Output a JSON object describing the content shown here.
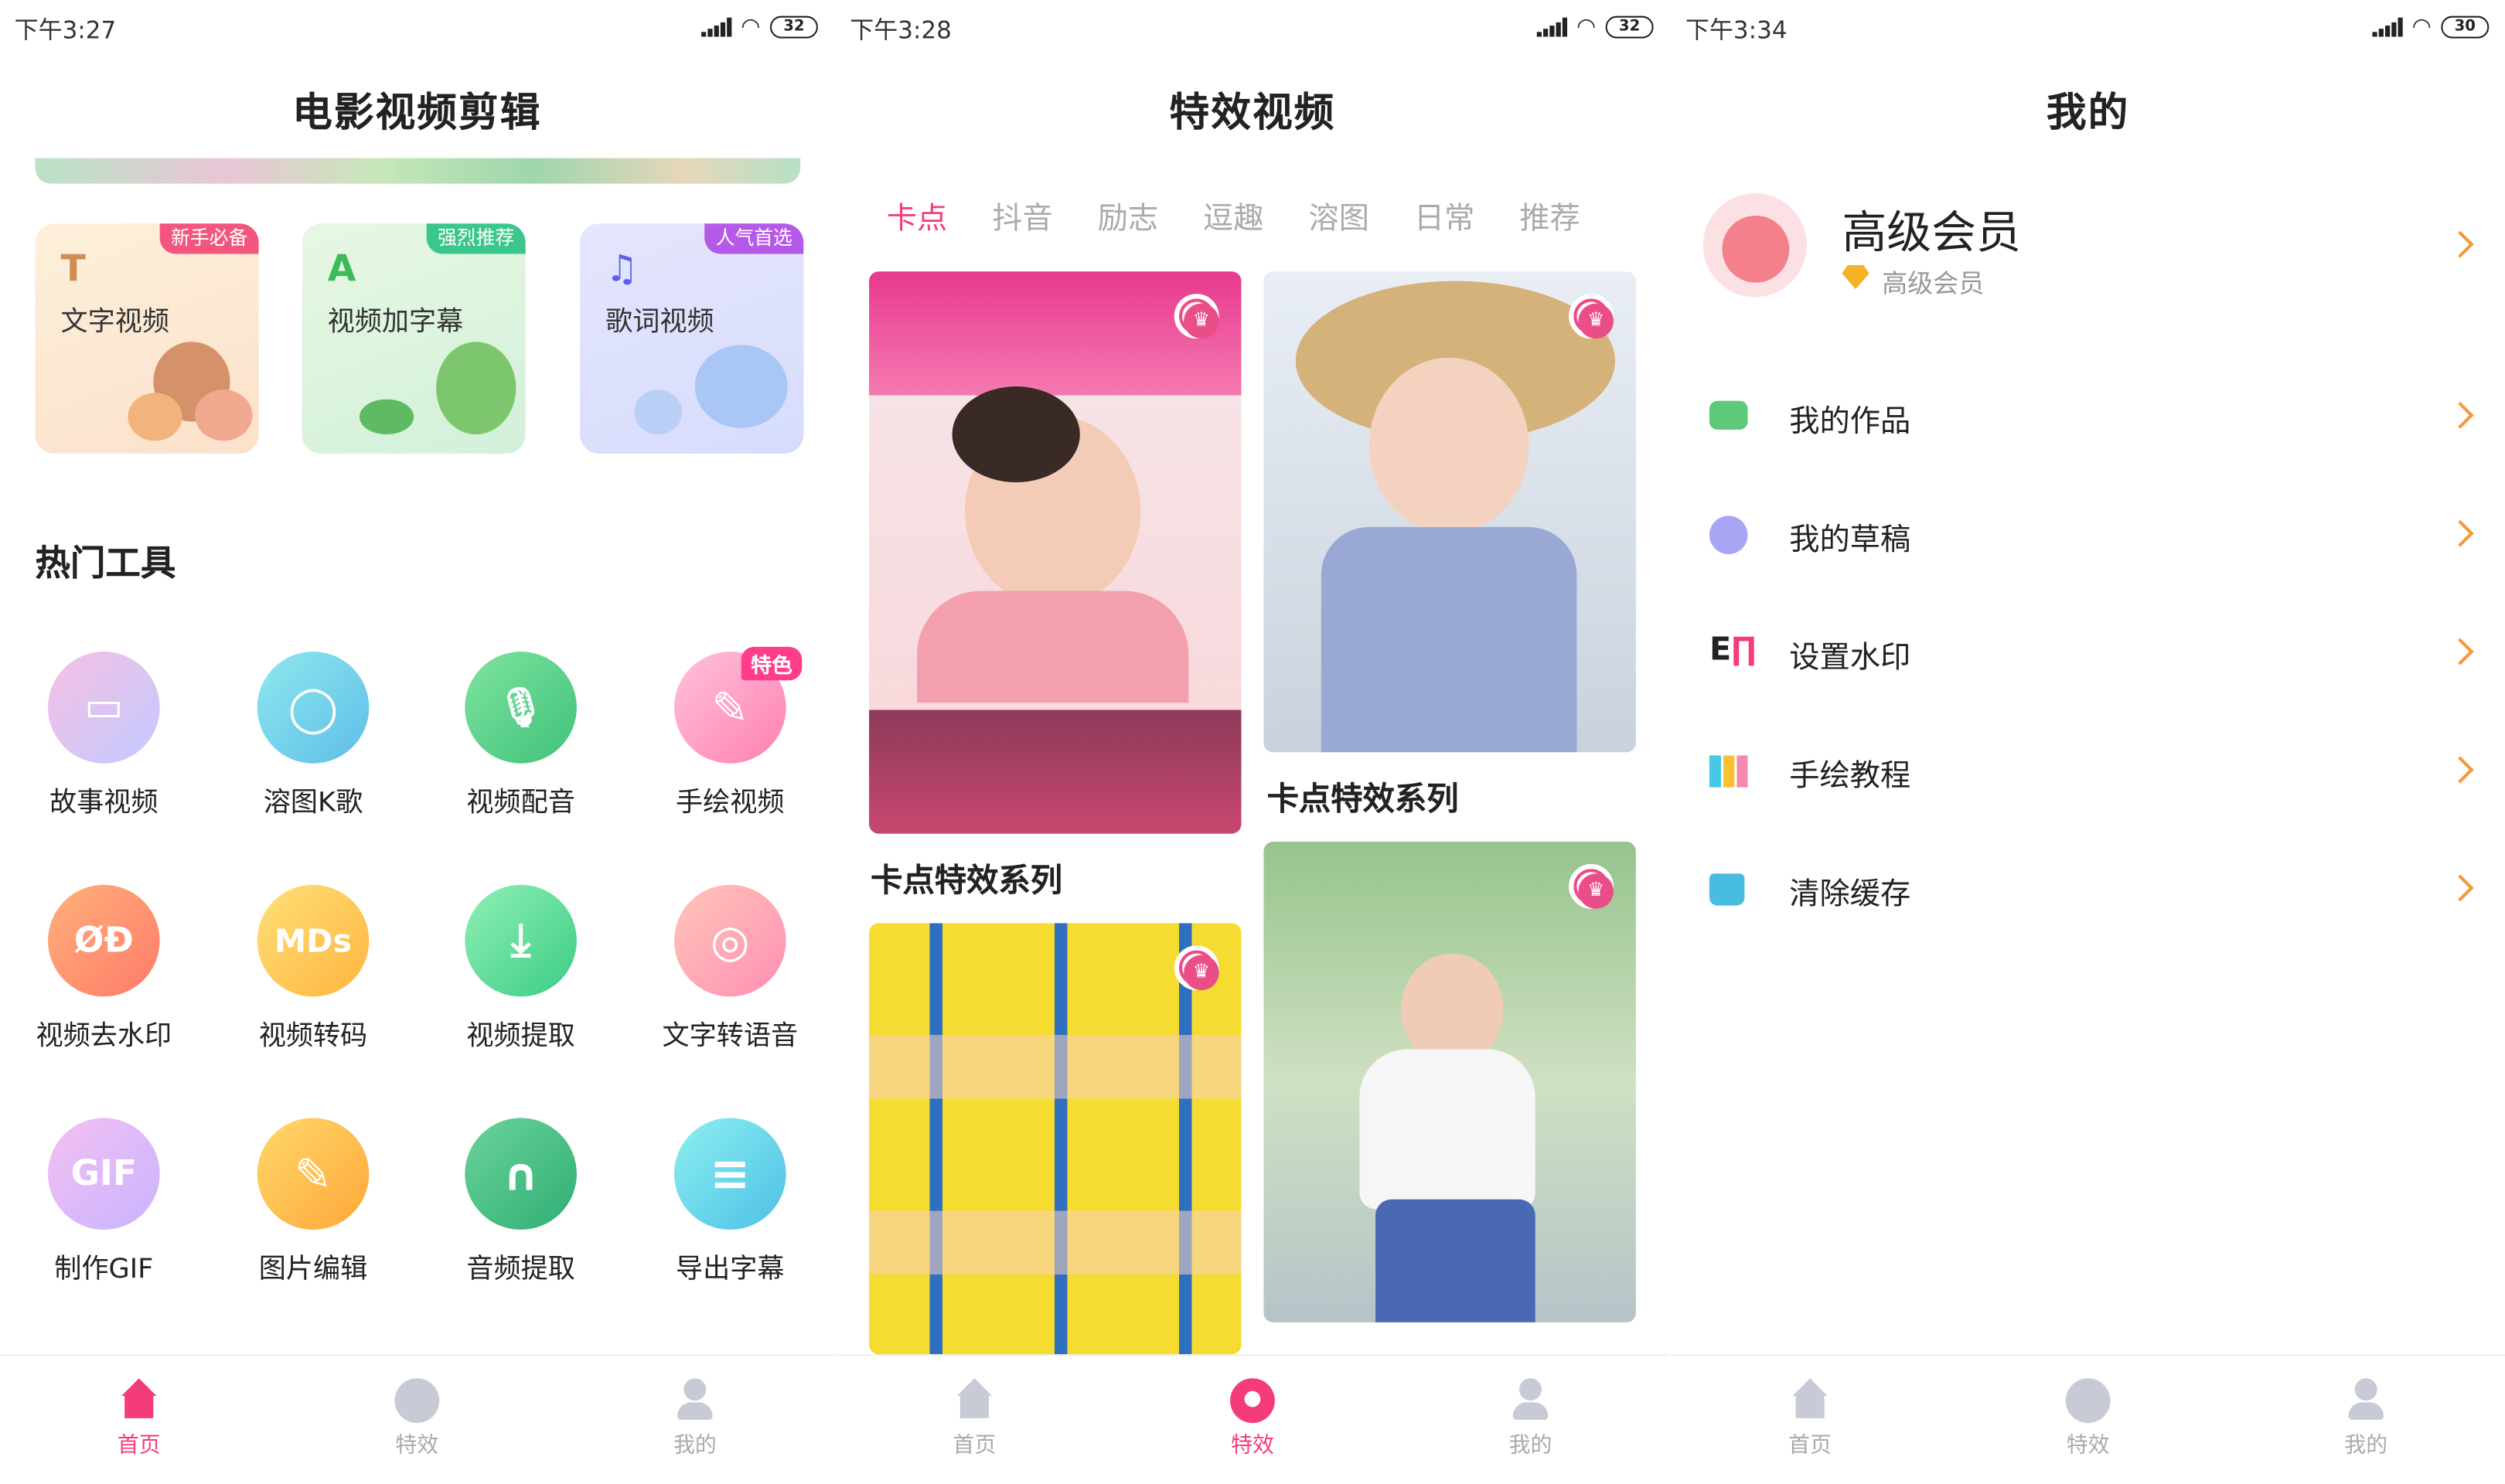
{
  "status": {
    "s1": {
      "time": "下午3:27",
      "battery": "32"
    },
    "s2": {
      "time": "下午3:28",
      "battery": "32"
    },
    "s3": {
      "time": "下午3:34",
      "battery": "30"
    }
  },
  "home": {
    "title": "电影视频剪辑",
    "features": [
      {
        "label": "文字视频",
        "tag": "新手必备",
        "icon": "T"
      },
      {
        "label": "视频加字幕",
        "tag": "强烈推荐",
        "icon": "A"
      },
      {
        "label": "歌词视频",
        "tag": "人气首选",
        "icon": "♫"
      }
    ],
    "section": "热门工具",
    "special_badge": "特色",
    "tools": [
      {
        "label": "故事视频",
        "icon": "film-icon",
        "glyph": "▭"
      },
      {
        "label": "溶图K歌",
        "icon": "chat-icon",
        "glyph": "◯"
      },
      {
        "label": "视频配音",
        "icon": "mic-icon",
        "glyph": "🎙"
      },
      {
        "label": "手绘视频",
        "icon": "pen-icon",
        "glyph": "✎"
      },
      {
        "label": "视频去水印",
        "icon": "no-video-icon",
        "glyph": "ØĐ"
      },
      {
        "label": "视频转码",
        "icon": "mds-icon",
        "glyph": "MDs"
      },
      {
        "label": "视频提取",
        "icon": "download-icon",
        "glyph": "⤓"
      },
      {
        "label": "文字转语音",
        "icon": "voice-icon",
        "glyph": "◎"
      },
      {
        "label": "制作GIF",
        "icon": "gif-icon",
        "glyph": "GIF"
      },
      {
        "label": "图片编辑",
        "icon": "edit-icon",
        "glyph": "✎"
      },
      {
        "label": "音频提取",
        "icon": "headphone-icon",
        "glyph": "∩"
      },
      {
        "label": "导出字幕",
        "icon": "list-icon",
        "glyph": "≡"
      }
    ]
  },
  "nav": {
    "home": "首页",
    "effects": "特效",
    "mine": "我的"
  },
  "effects": {
    "title": "特效视频",
    "tabs": [
      "卡点",
      "抖音",
      "励志",
      "逗趣",
      "溶图",
      "日常",
      "推荐"
    ],
    "cards": [
      {
        "title": "卡点特效系列"
      },
      {
        "title": "卡点特效系列"
      }
    ]
  },
  "mine": {
    "title": "我的",
    "user": "高级会员",
    "level": "高级会员",
    "rows": [
      {
        "label": "我的作品",
        "icon": "video-camera-icon"
      },
      {
        "label": "我的草稿",
        "icon": "draft-icon"
      },
      {
        "label": "设置水印",
        "icon": "watermark-icon"
      },
      {
        "label": "手绘教程",
        "icon": "books-icon"
      },
      {
        "label": "清除缓存",
        "icon": "clean-icon"
      }
    ]
  },
  "colors": {
    "accent": "#f53c7b",
    "chevron": "#f29a3e"
  }
}
